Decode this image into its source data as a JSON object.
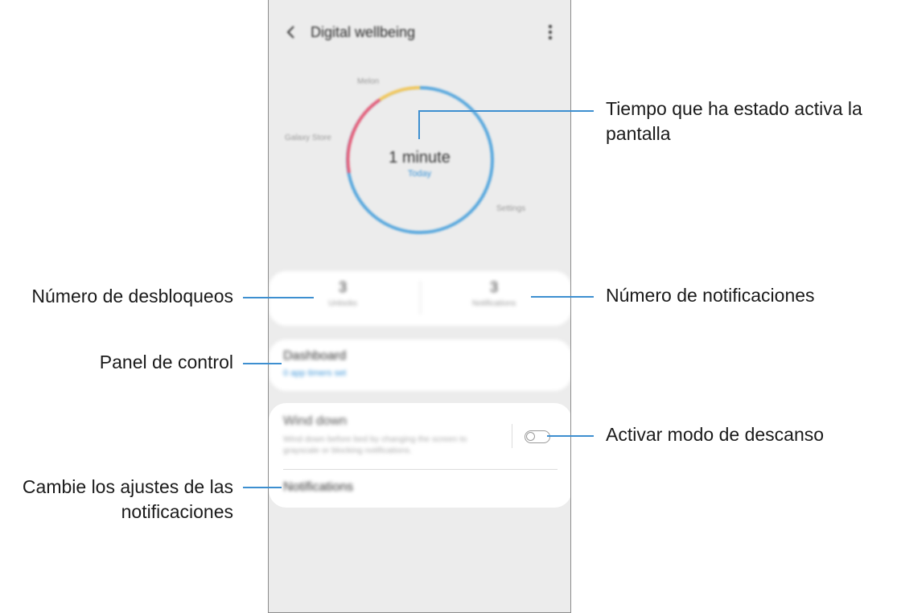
{
  "phone": {
    "title": "Digital wellbeing",
    "donut": {
      "value": "1 minute",
      "sub": "Today",
      "labels": [
        "Melon",
        "Galaxy Store",
        "Settings"
      ]
    },
    "stats": {
      "unlocks_value": "3",
      "unlocks_label": "Unlocks",
      "notifications_value": "3",
      "notifications_label": "Notifications"
    },
    "dashboard": {
      "title": "Dashboard",
      "sub": "0 app timers set"
    },
    "wind_down": {
      "title": "Wind down",
      "description": "Wind down before bed by changing the screen to grayscale or blocking notifications.",
      "toggle_on": false
    },
    "notifications_item": "Notifications"
  },
  "callouts": {
    "screen_time_line1": "Tiempo que ha estado activa la",
    "screen_time_line2": "pantalla",
    "unlocks": "Número de desbloqueos",
    "notifications": "Número de notificaciones",
    "dashboard": "Panel de control",
    "wind_down": "Activar modo de descanso",
    "notif_settings_line1": "Cambie los ajustes de las",
    "notif_settings_line2": "notificaciones"
  },
  "colors": {
    "accent": "#3d8fd0",
    "ring_blue": "#57a7dd",
    "ring_red": "#e45f7a",
    "ring_yellow": "#f2c75c"
  }
}
